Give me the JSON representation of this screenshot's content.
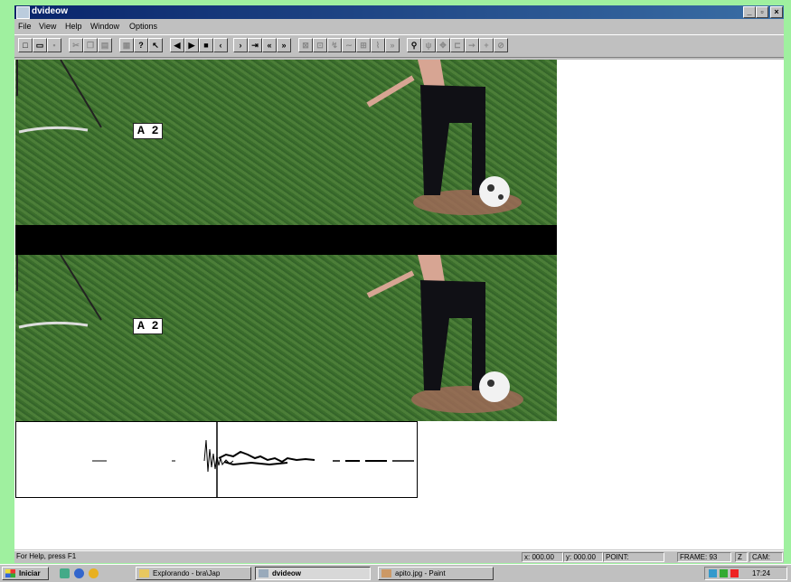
{
  "window": {
    "title": "dvideow"
  },
  "menu": [
    "File",
    "View",
    "Help",
    "Window",
    "Options"
  ],
  "video": {
    "sign_text": "A 2"
  },
  "status": {
    "help": "For Help, press F1",
    "x": "x: 000.00",
    "y": "y: 000.00",
    "point": "POINT:",
    "frame": "FRAME: 93",
    "z": "Z",
    "cam": "CAM:"
  },
  "taskbar": {
    "start": "Iniciar",
    "tasks": [
      "Explorando - bra\\Jap",
      "dvideow",
      "apito.jpg - Paint"
    ],
    "clock": "17:24"
  },
  "icons": {
    "toolbar": [
      "new-file-icon",
      "open-folder-icon",
      "save-icon",
      "cut-icon",
      "copy-icon",
      "paste-icon",
      "print-icon",
      "help-icon",
      "context-help-icon",
      "step-back-icon",
      "play-icon",
      "stop-icon",
      "prev-icon",
      "next-icon",
      "last-frame-icon",
      "rewind-icon",
      "fast-forward-icon"
    ]
  }
}
